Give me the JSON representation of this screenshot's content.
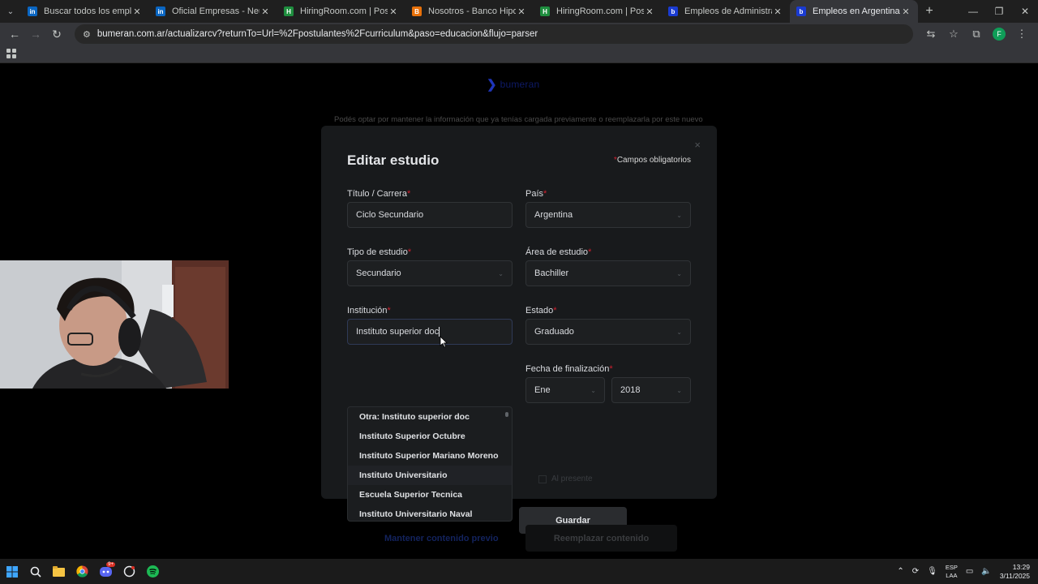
{
  "browser": {
    "tabs": [
      {
        "title": "Buscar todos los empleos | LinkedIn",
        "favicon": "in",
        "favicon_color": "#0a66c2",
        "active": false
      },
      {
        "title": "Oficial Empresas - Neuquén | Bolsa",
        "favicon": "in",
        "favicon_color": "#0a66c2",
        "active": false
      },
      {
        "title": "HiringRoom.com | Postularme",
        "favicon": "H",
        "favicon_color": "#1e8e3e",
        "active": false
      },
      {
        "title": "Nosotros - Banco Hipotecario",
        "favicon": "B",
        "favicon_color": "#e8710a",
        "active": false
      },
      {
        "title": "HiringRoom.com | Postularme",
        "favicon": "H",
        "favicon_color": "#1e8e3e",
        "active": false
      },
      {
        "title": "Empleos de Administración, Co",
        "favicon": "b",
        "favicon_color": "#1a3bd1",
        "active": false
      },
      {
        "title": "Empleos en Argentina: trabajo",
        "favicon": "b",
        "favicon_color": "#1a3bd1",
        "active": true
      }
    ],
    "url": "bumeran.com.ar/actualizarcv?returnTo=Url=%2Fpostulantes%2Fcurriculum&paso=educacion&flujo=parser",
    "profile_initial": "F"
  },
  "page": {
    "logo_text": "bumeran",
    "notice": "Podés optar por mantener la información que ya tenías cargada previamente o reemplazarla por este nuevo",
    "keep_link": "Mantener contenido previo",
    "replace_button": "Reemplazar contenido"
  },
  "modal": {
    "title": "Editar estudio",
    "required_note": "Campos obligatorios",
    "close": "×",
    "fields": {
      "titulo": {
        "label": "Título / Carrera",
        "value": "Ciclo Secundario"
      },
      "pais": {
        "label": "País",
        "value": "Argentina"
      },
      "tipo": {
        "label": "Tipo de estudio",
        "value": "Secundario"
      },
      "area": {
        "label": "Área de estudio",
        "value": "Bachiller"
      },
      "institucion": {
        "label": "Institución",
        "value": "Instituto superior doc"
      },
      "estado": {
        "label": "Estado",
        "value": "Graduado"
      },
      "fecha_fin": {
        "label": "Fecha de finalización",
        "month": "Ene",
        "year": "2018"
      }
    },
    "present_label": "Al presente",
    "save_button": "Guardar",
    "dropdown_options": [
      "Otra: Instituto superior doc",
      "Instituto Superior Octubre",
      "Instituto Superior Mariano Moreno",
      "Instituto Universitario",
      "Escuela Superior Tecnica",
      "Instituto Universitario Naval"
    ]
  },
  "taskbar": {
    "lang_line1": "ESP",
    "lang_line2": "LAA",
    "time": "13:29",
    "date": "3/11/2025",
    "discord_badge": "9+"
  }
}
